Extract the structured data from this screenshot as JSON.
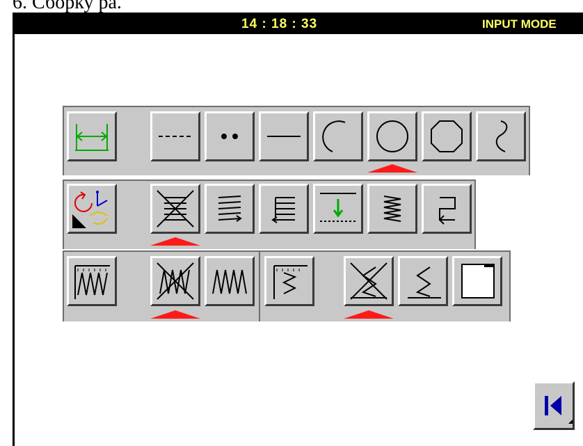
{
  "caption": "6.      Сборку ра.",
  "header": {
    "clock": "14 : 18 : 33",
    "mode": "INPUT MODE"
  },
  "colors": {
    "panel": "#c8c8c8",
    "header_bg": "#000000",
    "header_text": "#ffff66",
    "selection_marker": "#ff1a1a",
    "accent_blue": "#0000aa",
    "accent_green": "#00aa00"
  },
  "rows": {
    "row1": {
      "name": "stitch-shape",
      "buttons": [
        {
          "icon": "length-measure-icon",
          "selected": false
        },
        {
          "icon": "dashed-line-icon",
          "selected": false
        },
        {
          "icon": "point-dots-icon",
          "selected": false
        },
        {
          "icon": "straight-line-icon",
          "selected": false
        },
        {
          "icon": "arc-icon",
          "selected": false
        },
        {
          "icon": "circle-icon",
          "selected": true
        },
        {
          "icon": "octagon-icon",
          "selected": false
        },
        {
          "icon": "curve-icon",
          "selected": false
        }
      ]
    },
    "row2": {
      "name": "feed-pattern",
      "buttons": [
        {
          "icon": "rotate-move-icon",
          "selected": false
        },
        {
          "icon": "crossed-fill-icon",
          "selected": true
        },
        {
          "icon": "forward-fill-icon",
          "selected": false
        },
        {
          "icon": "reverse-fill-icon",
          "selected": false
        },
        {
          "icon": "drop-down-icon",
          "selected": false
        },
        {
          "icon": "zigzag-fill-icon",
          "selected": false
        },
        {
          "icon": "loop-back-icon",
          "selected": false
        }
      ]
    },
    "row3": {
      "name": "zigzag-type",
      "buttons": [
        {
          "icon": "zigzag-scale-icon",
          "selected": false
        },
        {
          "icon": "zigzag-off-icon",
          "selected": true
        },
        {
          "icon": "zigzag-on-icon",
          "selected": false
        },
        {
          "icon": "zigzag-ruler-icon",
          "selected": false
        },
        {
          "icon": "zigzag-cross-icon",
          "selected": true
        },
        {
          "icon": "zigzag-single-icon",
          "selected": false
        },
        {
          "icon": "blank-square-icon",
          "selected": false
        }
      ]
    }
  },
  "nav": {
    "back_icon": "skip-back-icon"
  }
}
